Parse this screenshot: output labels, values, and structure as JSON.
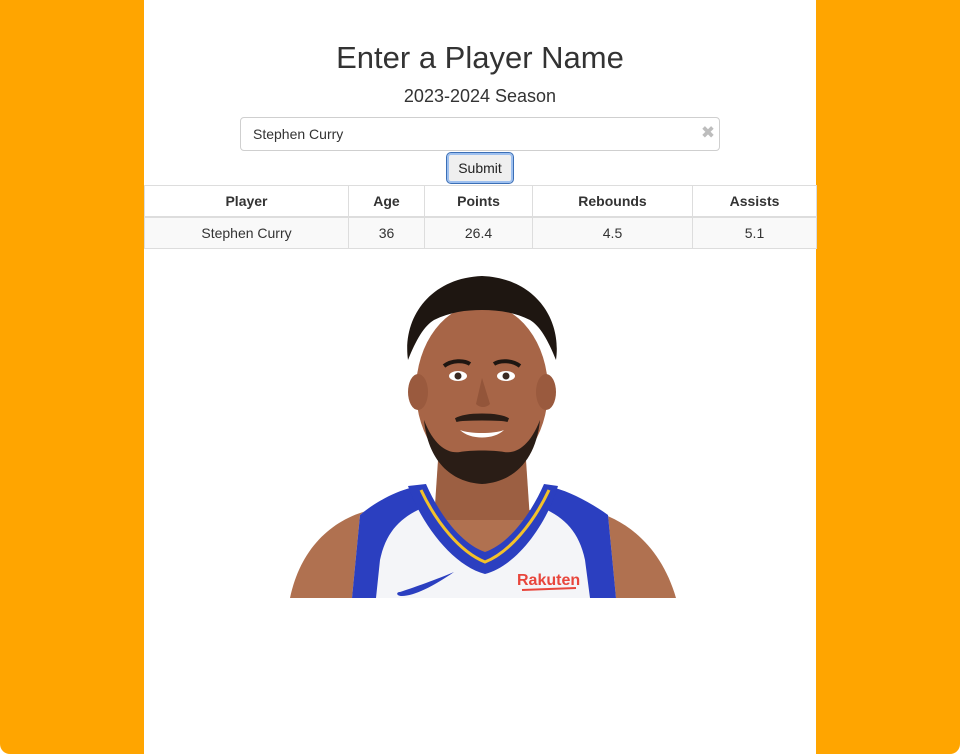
{
  "colors": {
    "background": "#FFA500",
    "panel": "#FFFFFF",
    "text": "#333333"
  },
  "header": {
    "title": "Enter a Player Name",
    "subtitle": "2023-2024 Season"
  },
  "search": {
    "value": "Stephen Curry",
    "clear_glyph": "✖",
    "submit_label": "Submit"
  },
  "table": {
    "columns": [
      "Player",
      "Age",
      "Points",
      "Rebounds",
      "Assists"
    ],
    "rows": [
      [
        "Stephen Curry",
        "36",
        "26.4",
        "4.5",
        "5.1"
      ]
    ]
  },
  "player_image": {
    "jersey_sponsor": "Rakuten",
    "logo": "swoosh-logo"
  }
}
